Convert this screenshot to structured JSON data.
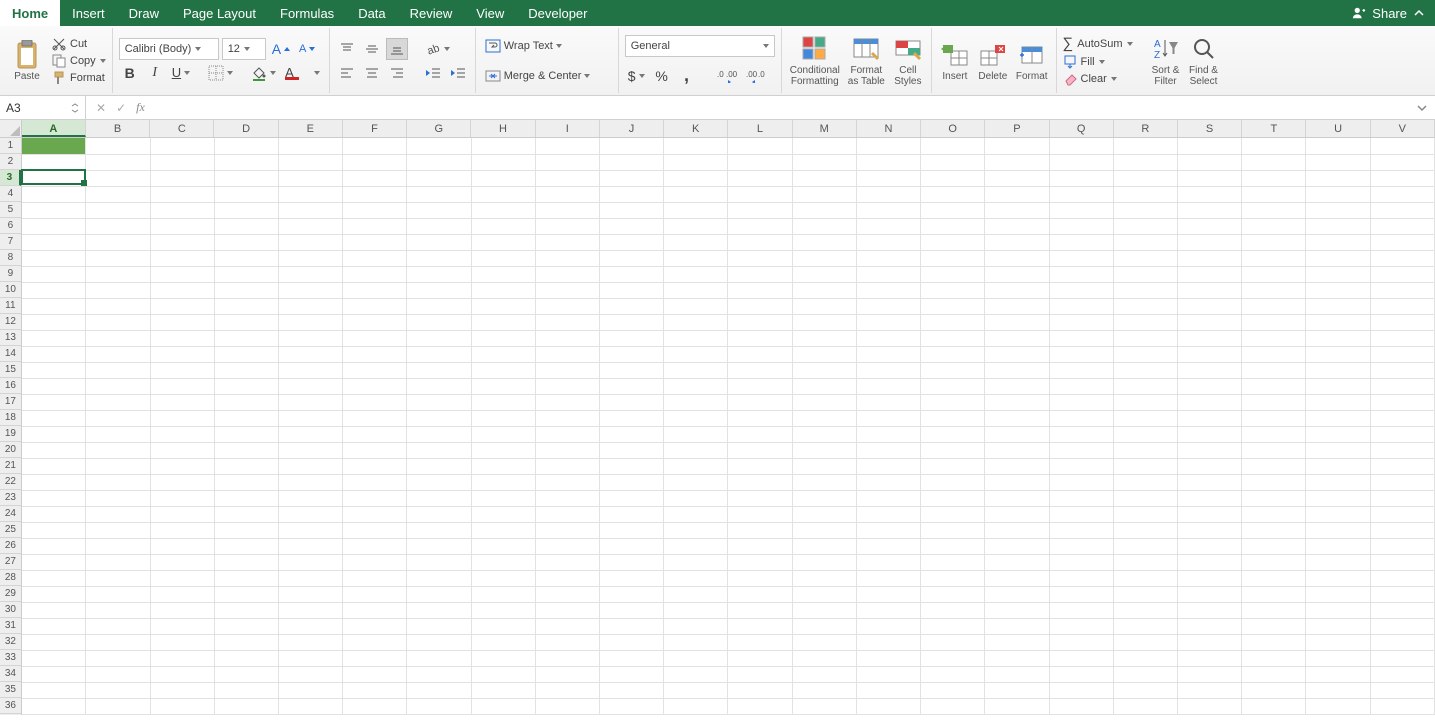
{
  "tabs": [
    "Home",
    "Insert",
    "Draw",
    "Page Layout",
    "Formulas",
    "Data",
    "Review",
    "View",
    "Developer"
  ],
  "active_tab": "Home",
  "share": "Share",
  "clipboard": {
    "paste": "Paste",
    "cut": "Cut",
    "copy": "Copy",
    "format": "Format"
  },
  "font": {
    "name": "Calibri (Body)",
    "size": "12"
  },
  "wrap": "Wrap Text",
  "merge": "Merge & Center",
  "number_format": "General",
  "styles": {
    "conditional": "Conditional\nFormatting",
    "table": "Format\nas Table",
    "cell": "Cell\nStyles"
  },
  "cells_group": {
    "insert": "Insert",
    "delete": "Delete",
    "format": "Format"
  },
  "editing": {
    "autosum": "AutoSum",
    "fill": "Fill",
    "clear": "Clear"
  },
  "sortfilter": "Sort &\nFilter",
  "findselect": "Find &\nSelect",
  "namebox": "A3",
  "columns": [
    "A",
    "B",
    "C",
    "D",
    "E",
    "F",
    "G",
    "H",
    "I",
    "J",
    "K",
    "L",
    "M",
    "N",
    "O",
    "P",
    "Q",
    "R",
    "S",
    "T",
    "U",
    "V"
  ],
  "active_col": "A",
  "rows": 36,
  "active_row": 3,
  "filled_cells": [
    {
      "r": 1,
      "c": "A",
      "bg": "#6AA84F"
    }
  ],
  "selected_cell": {
    "r": 3,
    "c": "A"
  }
}
